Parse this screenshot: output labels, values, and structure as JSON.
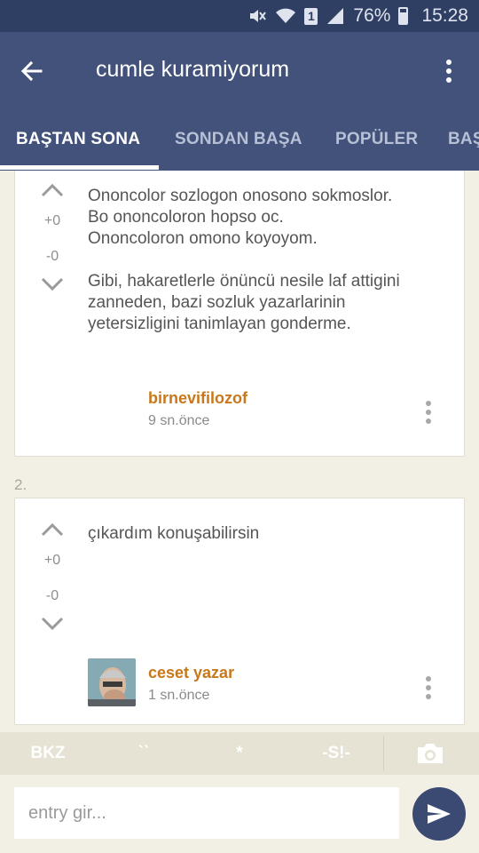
{
  "status_bar": {
    "battery": "76%",
    "time": "15:28",
    "sim": "1",
    "icons": [
      "mute-icon",
      "wifi-icon",
      "sim-icon",
      "signal-icon",
      "battery-icon"
    ]
  },
  "app_bar": {
    "title": "cumle kuramiyorum",
    "back_icon": "arrow-left-icon",
    "menu_icon": "more-vert-icon"
  },
  "tabs": [
    {
      "label": "BAŞTAN SONA",
      "active": true
    },
    {
      "label": "SONDAN BAŞA",
      "active": false
    },
    {
      "label": "POPÜLER",
      "active": false
    },
    {
      "label": "BAŞ",
      "active": false
    }
  ],
  "entries": [
    {
      "number": "",
      "text": "Ononcolor sozlogon onosono sokmoslor.\nBo ononcoloron hopso oc.\nOnoncoloron omono koyoyom.\n\nGibi, hakaretlerle önüncü nesile laf attigini zanneden, bazi sozluk yazarlarinin yetersizligini tanimlayan gonderme.",
      "upvotes": "+0",
      "downvotes": "-0",
      "author": "birnevifilozof",
      "time": "9 sn.önce",
      "has_avatar": false
    },
    {
      "number": "2.",
      "text": "çıkardım konuşabilirsin",
      "upvotes": "+0",
      "downvotes": "-0",
      "author": "ceset yazar",
      "time": "1 sn.önce",
      "has_avatar": true
    }
  ],
  "toolbar": {
    "bkz": "BKZ",
    "backticks": "``",
    "star": "*",
    "spoiler": "-S!-",
    "camera_icon": "camera-icon"
  },
  "input": {
    "placeholder": "entry gir...",
    "value": ""
  },
  "colors": {
    "status_bar": "#2f3e63",
    "app_bar": "#42527a",
    "author": "#c8781a",
    "send_button": "#3a4a73",
    "background": "#f2efe4"
  }
}
